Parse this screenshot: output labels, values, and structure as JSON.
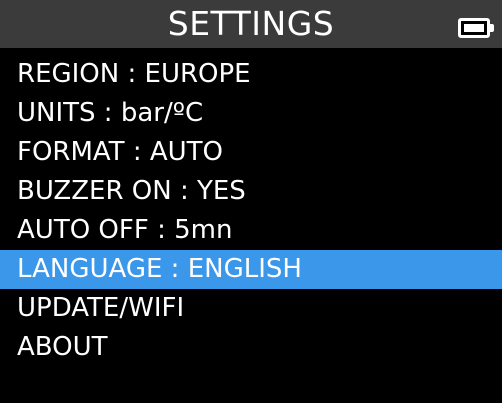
{
  "header": {
    "title": "SETTINGS",
    "battery_icon": "battery-icon"
  },
  "menu": {
    "selected_index": 6,
    "items": [
      {
        "label": "REGION : EUROPE"
      },
      {
        "label": "UNITS : bar/ºC"
      },
      {
        "label": "FORMAT : AUTO"
      },
      {
        "label": "BUZZER ON : YES"
      },
      {
        "label": "AUTO OFF : 5mn"
      },
      {
        "label": "LANGUAGE : ENGLISH"
      },
      {
        "label": "UPDATE/WIFI"
      },
      {
        "label": "ABOUT"
      }
    ]
  },
  "colors": {
    "header_background": "#3b3b3b",
    "selection": "#3a97ea",
    "background": "#000000",
    "text": "#ffffff"
  }
}
